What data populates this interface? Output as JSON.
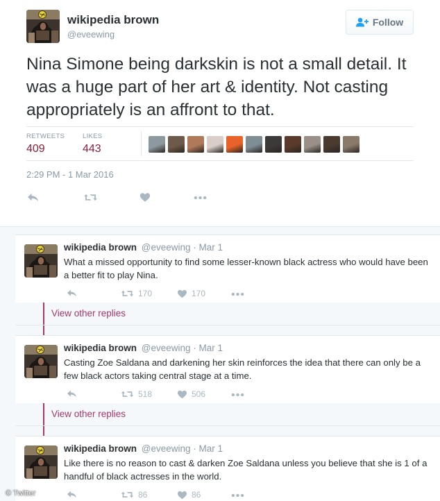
{
  "main_tweet": {
    "name": "wikipedia brown",
    "handle": "@eveewing",
    "follow_label": "Follow",
    "text": "Nina Simone being darkskin is not a small detail. It was a huge part of her art & identity. Not casting appropriately is an affront to that.",
    "retweets_label": "RETWEETS",
    "retweets_count": "409",
    "likes_label": "LIKES",
    "likes_count": "443",
    "timestamp": "2:29 PM - 1 Mar 2016",
    "liker_avatar_colors": [
      "#8c9aa0",
      "#6e5a4a",
      "#b07a5a",
      "#d9cfc8",
      "#e8632a",
      "#7f8e94",
      "#3c3a38",
      "#5a3a2a",
      "#9a9088",
      "#4a3a30",
      "#8a7a6a"
    ]
  },
  "replies": [
    {
      "name": "wikipedia brown",
      "meta": "@eveewing · Mar 1",
      "text": "What a missed opportunity to find some lesser-known black actress who would have been a better fit to play Nina.",
      "retweets": "170",
      "likes": "170",
      "view_other": "View other replies"
    },
    {
      "name": "wikipedia brown",
      "meta": "@eveewing · Mar 1",
      "text": "Casting Zoe Saldana and darkening her skin reinforces the idea that there can only be a few black actors taking central stage at a time.",
      "retweets": "518",
      "likes": "506",
      "view_other": "View other replies"
    },
    {
      "name": "wikipedia brown",
      "meta": "@eveewing · Mar 1",
      "text": "Like there is no reason to cast & darken Zoe Saldana unless you believe that she is 1 of a handful of black actresses in the world.",
      "retweets": "86",
      "likes": "86"
    }
  ],
  "watermark": "© Twitter",
  "colors": {
    "accent": "#a2386a",
    "stat_value": "#8a1f3c",
    "muted": "#8899a6",
    "action_icon": "#aab8c2"
  },
  "icons": [
    "user-plus-icon",
    "reply-icon",
    "retweet-icon",
    "heart-icon",
    "more-icon"
  ]
}
